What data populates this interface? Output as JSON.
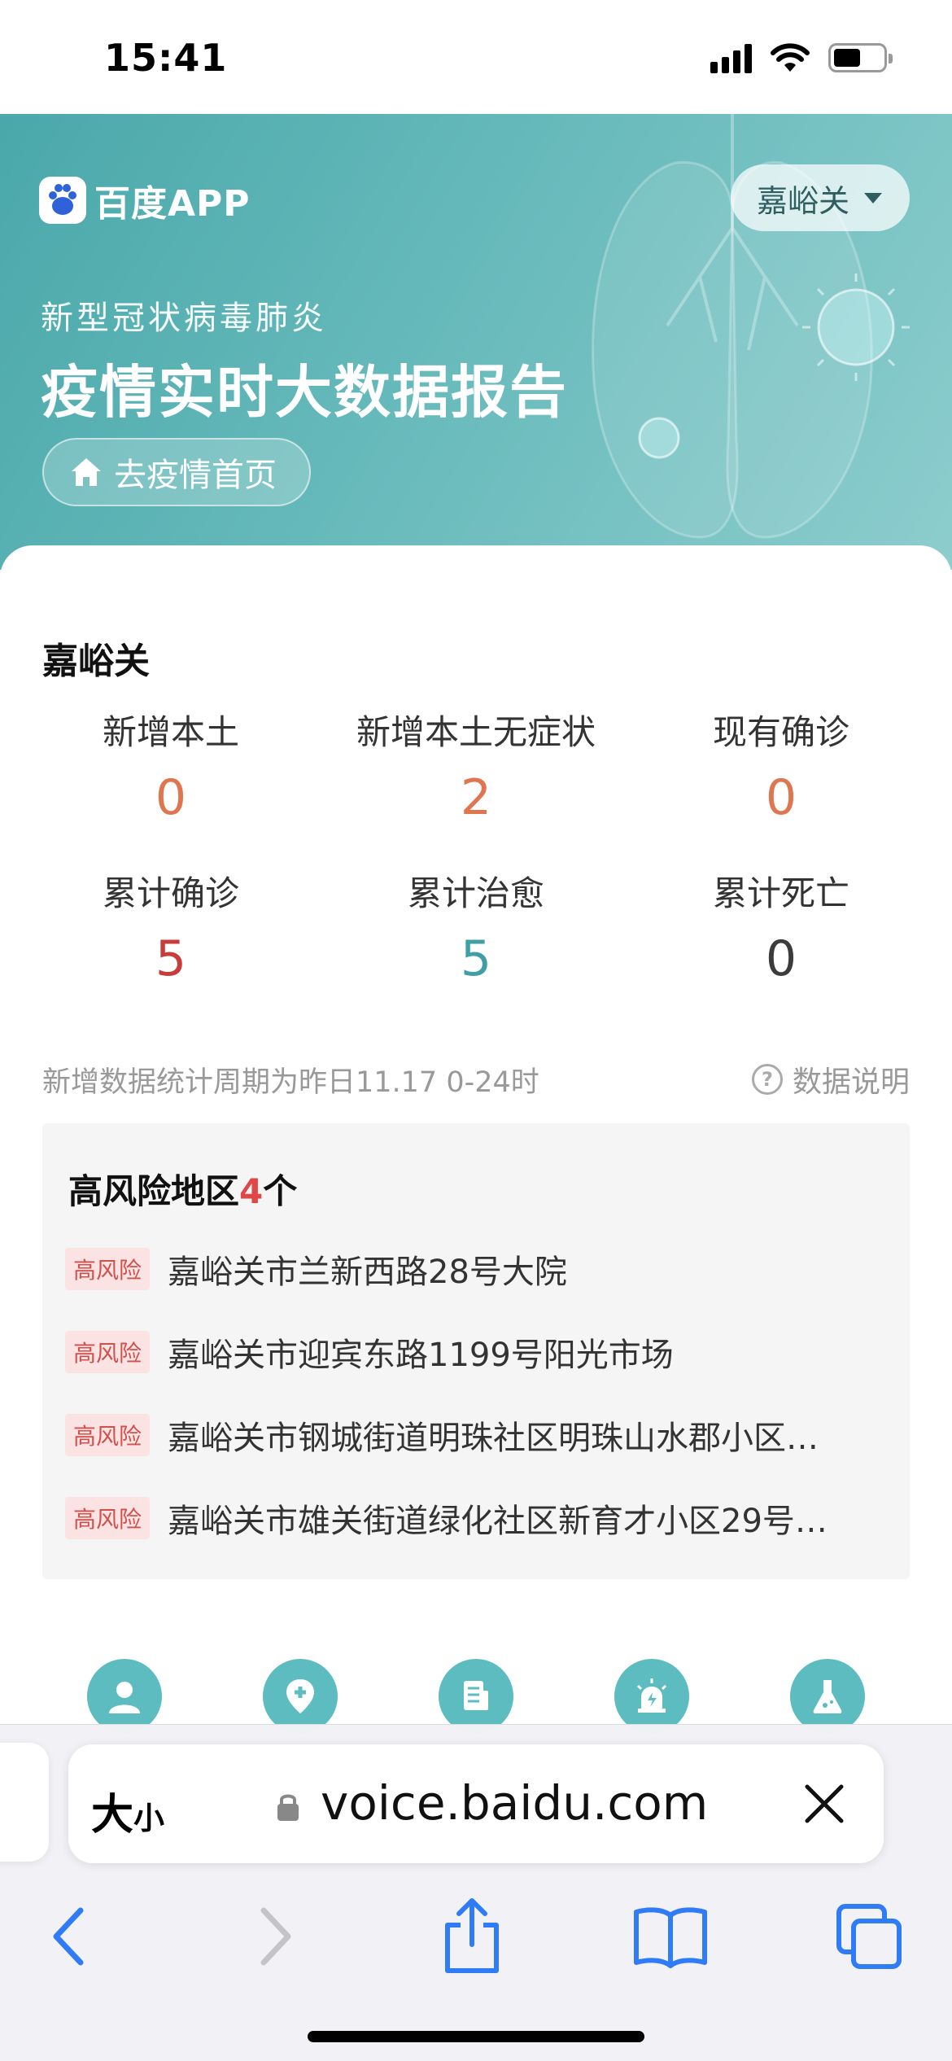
{
  "status_bar": {
    "time": "15:41"
  },
  "hero": {
    "logo_text": "百度APP",
    "city_select": "嘉峪关",
    "subtitle": "新型冠状病毒肺炎",
    "title": "疫情实时大数据报告",
    "home_button": "去疫情首页"
  },
  "region": {
    "name": "嘉峪关",
    "stats": [
      {
        "label": "新增本土",
        "value": "0"
      },
      {
        "label": "新增本土无症状",
        "value": "2"
      },
      {
        "label": "现有确诊",
        "value": "0"
      },
      {
        "label": "累计确诊",
        "value": "5"
      },
      {
        "label": "累计治愈",
        "value": "5"
      },
      {
        "label": "累计死亡",
        "value": "0"
      }
    ],
    "note": "新增数据统计周期为昨日11.17 0-24时",
    "data_help": "数据说明"
  },
  "risk": {
    "title_prefix": "高风险地区",
    "count": "4",
    "title_suffix": "个",
    "badge": "高风险",
    "areas": [
      "嘉峪关市兰新西路28号大院",
      "嘉峪关市迎宾东路1199号阳光市场",
      "嘉峪关市钢城街道明珠社区明珠山水郡小区…",
      "嘉峪关市雄关街道绿化社区新育才小区29号…"
    ]
  },
  "browser": {
    "text_size_big": "大",
    "text_size_small": "小",
    "url": "voice.baidu.com"
  },
  "colors": {
    "accent_teal": "#5cbcbf",
    "stat_orange": "#e07650",
    "stat_red": "#c93c3c",
    "stat_teal": "#3f9fa5",
    "risk_red": "#e04848",
    "ios_blue": "#2f7cf6"
  }
}
